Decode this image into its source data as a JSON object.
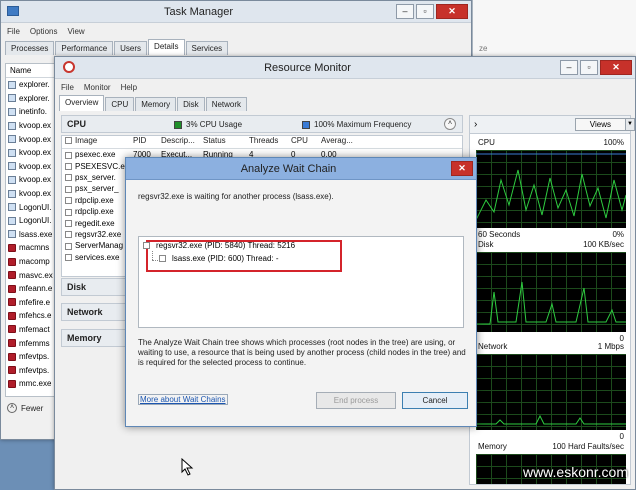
{
  "task_manager": {
    "title": "Task Manager",
    "menu": [
      "File",
      "Options",
      "View"
    ],
    "tabs": [
      "Processes",
      "Performance",
      "Users",
      "Details",
      "Services"
    ],
    "active_tab": "Details",
    "column_name": "Name",
    "processes": [
      {
        "name": "explorer.",
        "icon": "app-icon"
      },
      {
        "name": "explorer.",
        "icon": "app-icon"
      },
      {
        "name": "inetinfo.",
        "icon": "app-icon"
      },
      {
        "name": "kvoop.ex",
        "icon": "app-icon"
      },
      {
        "name": "kvoop.ex",
        "icon": "app-icon"
      },
      {
        "name": "kvoop.ex",
        "icon": "app-icon"
      },
      {
        "name": "kvoop.ex",
        "icon": "app-icon"
      },
      {
        "name": "kvoop.ex",
        "icon": "app-icon"
      },
      {
        "name": "kvoop.ex",
        "icon": "app-icon"
      },
      {
        "name": "LogonUI.",
        "icon": "app-icon"
      },
      {
        "name": "LogonUI.",
        "icon": "app-icon"
      },
      {
        "name": "lsass.exe",
        "icon": "app-icon"
      },
      {
        "name": "macmns",
        "icon": "mcafee-icon"
      },
      {
        "name": "macomp",
        "icon": "mcafee-icon"
      },
      {
        "name": "masvc.ex",
        "icon": "mcafee-icon"
      },
      {
        "name": "mfeann.e",
        "icon": "mcafee-icon"
      },
      {
        "name": "mfefire.e",
        "icon": "mcafee-icon"
      },
      {
        "name": "mfehcs.e",
        "icon": "mcafee-icon"
      },
      {
        "name": "mfemact",
        "icon": "mcafee-icon"
      },
      {
        "name": "mfemms",
        "icon": "mcafee-icon"
      },
      {
        "name": "mfevtps.",
        "icon": "mcafee-icon"
      },
      {
        "name": "mfevtps.",
        "icon": "mcafee-icon"
      },
      {
        "name": "mmc.exe",
        "icon": "mcafee-icon"
      }
    ],
    "fewer_details": "Fewer"
  },
  "background_window": {
    "text": "ze"
  },
  "resource_monitor": {
    "title": "Resource Monitor",
    "menu": [
      "File",
      "Monitor",
      "Help"
    ],
    "tabs": [
      "Overview",
      "CPU",
      "Memory",
      "Disk",
      "Network"
    ],
    "active_tab": "Overview",
    "cpu_section": {
      "label": "CPU",
      "usage": "3% CPU Usage",
      "usage_color": "#1f8f2a",
      "frequency": "100% Maximum Frequency",
      "frequency_color": "#3a7bd5"
    },
    "cpu_columns": [
      "Image",
      "PID",
      "Descrip...",
      "Status",
      "Threads",
      "CPU",
      "Averag..."
    ],
    "cpu_rows": [
      {
        "image": "psexec.exe",
        "pid": "7000",
        "desc": "Execut...",
        "status": "Running",
        "threads": "4",
        "cpu": "0",
        "avg": "0.00"
      },
      {
        "image": "PSEXESVC.exe",
        "pid": "",
        "desc": "",
        "status": "",
        "threads": "",
        "cpu": "",
        "avg": ""
      },
      {
        "image": "psx_server.",
        "pid": "",
        "desc": "",
        "status": "",
        "threads": "",
        "cpu": "",
        "avg": ""
      },
      {
        "image": "psx_server_",
        "pid": "",
        "desc": "",
        "status": "",
        "threads": "",
        "cpu": "",
        "avg": ""
      },
      {
        "image": "rdpclip.exe",
        "pid": "",
        "desc": "",
        "status": "",
        "threads": "",
        "cpu": "",
        "avg": ""
      },
      {
        "image": "rdpclip.exe",
        "pid": "",
        "desc": "",
        "status": "",
        "threads": "",
        "cpu": "",
        "avg": ""
      },
      {
        "image": "regedit.exe",
        "pid": "",
        "desc": "",
        "status": "",
        "threads": "",
        "cpu": "",
        "avg": ""
      },
      {
        "image": "regsvr32.exe",
        "pid": "",
        "desc": "",
        "status": "",
        "threads": "",
        "cpu": "",
        "avg": ""
      },
      {
        "image": "ServerManag",
        "pid": "",
        "desc": "",
        "status": "",
        "threads": "",
        "cpu": "",
        "avg": ""
      },
      {
        "image": "services.exe",
        "pid": "",
        "desc": "",
        "status": "",
        "threads": "",
        "cpu": "",
        "avg": ""
      }
    ],
    "sections": [
      "Disk",
      "Network",
      "Memory"
    ],
    "views_label": "Views",
    "graphs": {
      "cpu": {
        "label": "CPU",
        "max": "100%",
        "min_time": "60 Seconds",
        "min": "0%"
      },
      "disk": {
        "label": "Disk",
        "max": "100 KB/sec",
        "min": "0"
      },
      "network": {
        "label": "Network",
        "max": "1 Mbps",
        "min": "0"
      },
      "memory": {
        "label": "Memory",
        "max": "100 Hard Faults/sec"
      }
    }
  },
  "dialog": {
    "title": "Analyze Wait Chain",
    "message": "regsvr32.exe is waiting for another process (lsass.exe).",
    "tree": [
      {
        "label": "regsvr32.exe (PID: 5840) Thread: 5216"
      },
      {
        "label": "lsass.exe (PID: 600) Thread: -"
      }
    ],
    "description": "The Analyze Wait Chain tree shows which processes (root nodes in the tree) are using, or waiting to use, a resource that is being used by another process (child nodes in the tree) and is required for the selected process to continue.",
    "link": "More about Wait Chains",
    "end_process": "End process",
    "cancel": "Cancel"
  },
  "watermark": "www.eskonr.com"
}
